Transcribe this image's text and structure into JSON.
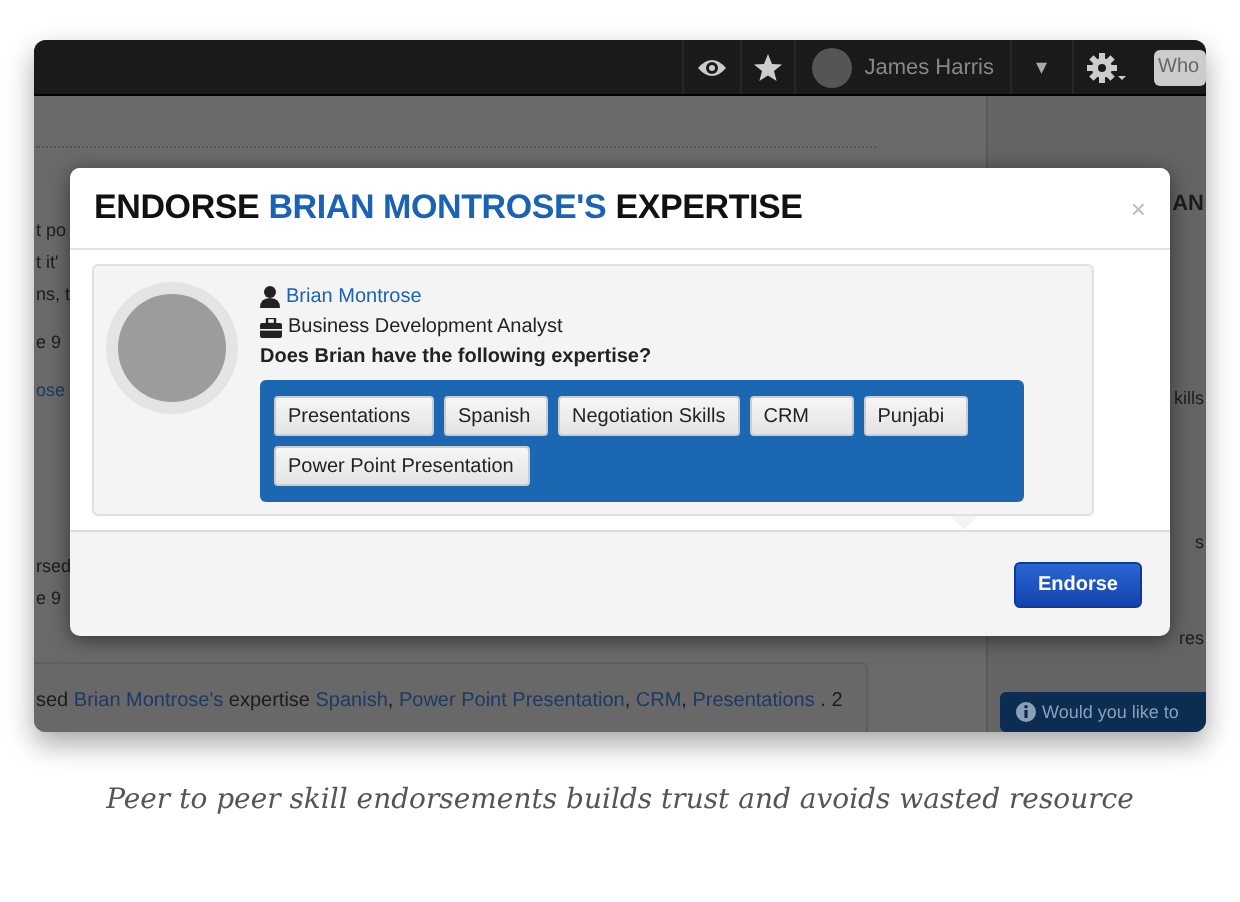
{
  "top_bar": {
    "user_name": "James Harris",
    "caret": "▾",
    "search": {
      "placeholder": "Who"
    }
  },
  "background_feed": {
    "left_lines": [
      {
        "text": "t po",
        "kind": "text"
      },
      {
        "text": "t it'",
        "kind": "text"
      },
      {
        "text": "ns, t",
        "kind": "text"
      },
      {
        "text": "e 9",
        "kind": "text"
      },
      {
        "text": "ose",
        "kind": "link"
      },
      {
        "text": "rsed",
        "kind": "text"
      },
      {
        "text": "e 9",
        "kind": "text"
      }
    ],
    "activity": [
      {
        "text": "sed ",
        "kind": "text"
      },
      {
        "text": "Brian Montrose's",
        "kind": "link"
      },
      {
        "text": " expertise ",
        "kind": "text"
      },
      {
        "text": "Spanish",
        "kind": "link"
      },
      {
        "text": ", ",
        "kind": "text"
      },
      {
        "text": "Power Point Presentation",
        "kind": "link"
      },
      {
        "text": ", ",
        "kind": "text"
      },
      {
        "text": "CRM",
        "kind": "link"
      },
      {
        "text": ", ",
        "kind": "text"
      },
      {
        "text": "Presentations",
        "kind": "link"
      },
      {
        "text": " . 2",
        "kind": "text"
      }
    ],
    "right_lines": [
      {
        "text": "AN",
        "kind": "heading"
      },
      {
        "text": "kills",
        "kind": "text"
      },
      {
        "text": "s",
        "kind": "text"
      },
      {
        "text": "res",
        "kind": "text"
      }
    ],
    "prompt_button": "Would you like to"
  },
  "dialog": {
    "title": [
      {
        "text": "ENDORSE ",
        "highlight": false
      },
      {
        "text": "BRIAN MONTROSE'S",
        "highlight": true
      },
      {
        "text": " EXPERTISE",
        "highlight": false
      }
    ],
    "close": "×",
    "person": {
      "name": "Brian Montrose",
      "job_title": "Business Development Analyst"
    },
    "question": "Does Brian have the following expertise?",
    "skills": [
      "Presentations",
      "Spanish",
      "Negotiation Skills",
      "CRM",
      "Punjabi",
      "Power Point Presentation"
    ],
    "buttons": [
      "Endorse"
    ]
  },
  "caption": "Peer to peer skill endorsements builds trust and avoids wasted resource"
}
